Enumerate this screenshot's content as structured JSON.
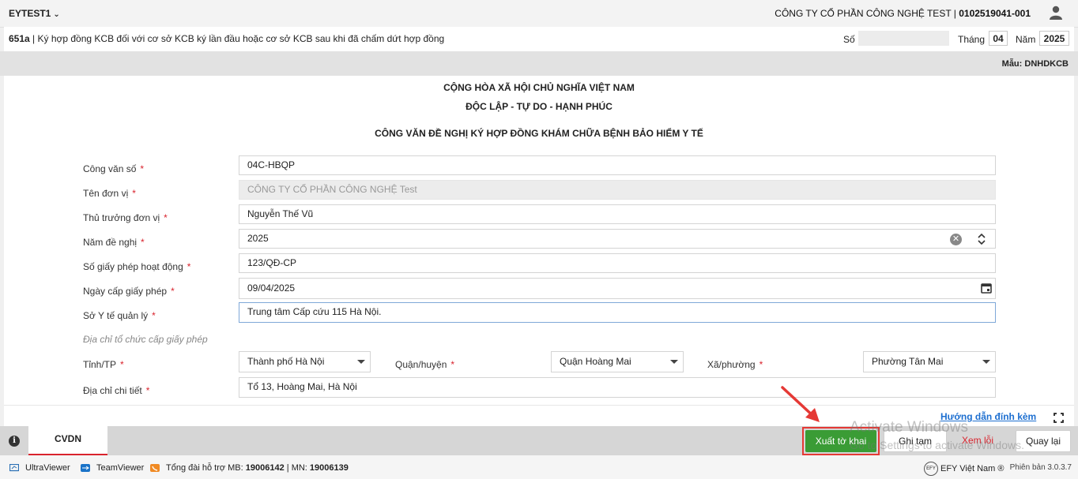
{
  "topbar": {
    "app_title": "EYTEST1",
    "company_name": "CÔNG TY CỔ PHẦN CÔNG NGHỆ TEST",
    "company_sep": " | ",
    "tax_code": "0102519041-001"
  },
  "formbar": {
    "code": "651a",
    "title": " | Ký hợp đồng KCB đối với cơ sở KCB ký lần đầu hoặc cơ sở KCB sau khi đã chấm dứt hợp đồng",
    "so_label": "Số",
    "so_value": "",
    "thang_label": "Tháng",
    "thang_value": "04",
    "nam_label": "Năm",
    "nam_value": "2025"
  },
  "template": {
    "label": "Mẫu:",
    "code": "DNHDKCB"
  },
  "document": {
    "header1": "CỘNG HÒA XÃ HỘI CHỦ NGHĨA VIỆT NAM",
    "header2": "ĐỘC LẬP - TỰ DO - HẠNH PHÚC",
    "title": "CÔNG VĂN ĐỀ NGHỊ KÝ HỢP ĐỒNG KHÁM CHỮA BỆNH BẢO HIỂM Y TẾ"
  },
  "fields": {
    "cong_van_so": {
      "label": "Công văn số",
      "value": "04C-HBQP"
    },
    "ten_don_vi": {
      "label": "Tên đơn vị",
      "value": "CÔNG TY CỔ PHẦN CÔNG NGHỆ Test"
    },
    "thu_truong": {
      "label": "Thủ trưởng đơn vị",
      "value": "Nguyễn Thế Vũ"
    },
    "nam_de_nghi": {
      "label": "Năm đề nghị",
      "value": "2025"
    },
    "so_giay_phep": {
      "label": "Số giấy phép hoạt động",
      "value": "123/QĐ-CP"
    },
    "ngay_cap": {
      "label": "Ngày cấp giấy phép",
      "value": "09/04/2025"
    },
    "so_y_te": {
      "label": "Sở Y tế quản lý",
      "value": "Trung tâm Cấp cứu 115 Hà Nội."
    },
    "hint": "Địa chỉ tổ chức cấp giấy phép",
    "tinh": {
      "label": "Tỉnh/TP",
      "value": "Thành phố Hà Nội"
    },
    "quan": {
      "label": "Quận/huyện",
      "value": "Quận Hoàng Mai"
    },
    "xa": {
      "label": "Xã/phường",
      "value": "Phường Tân Mai"
    },
    "dia_chi": {
      "label": "Địa chỉ chi tiết",
      "value": "Tổ 13, Hoàng Mai, Hà Nội"
    },
    "required_mark": "*"
  },
  "footer": {
    "guide_link": "Hướng dẫn đính kèm"
  },
  "tabs": {
    "cvdn": "CVDN",
    "info": "i"
  },
  "buttons": {
    "xuat": "Xuất tờ khai",
    "ghi_tam": "Ghi tạm",
    "xem_loi": "Xem lỗi",
    "quay_lai": "Quay lại"
  },
  "watermark": {
    "line1": "Activate Windows",
    "line2": "Go to Settings to activate Windows."
  },
  "statusbar": {
    "ultraviewer": "UltraViewer",
    "teamviewer": "TeamViewer",
    "hotline_label": "Tổng đài hỗ trợ MB:",
    "hotline_mb": "19006142",
    "hotline_sep": " | MN: ",
    "hotline_mn": "19006139",
    "efy": "EFY Việt Nam",
    "efy_mark": "®",
    "efy_logo": "EFY",
    "version": "Phiên bản 3.0.3.7"
  },
  "colors": {
    "primary_green": "#3a9c35",
    "required_red": "#d9232d",
    "link_blue": "#1d6fd0",
    "highlight_red": "#e53935"
  }
}
